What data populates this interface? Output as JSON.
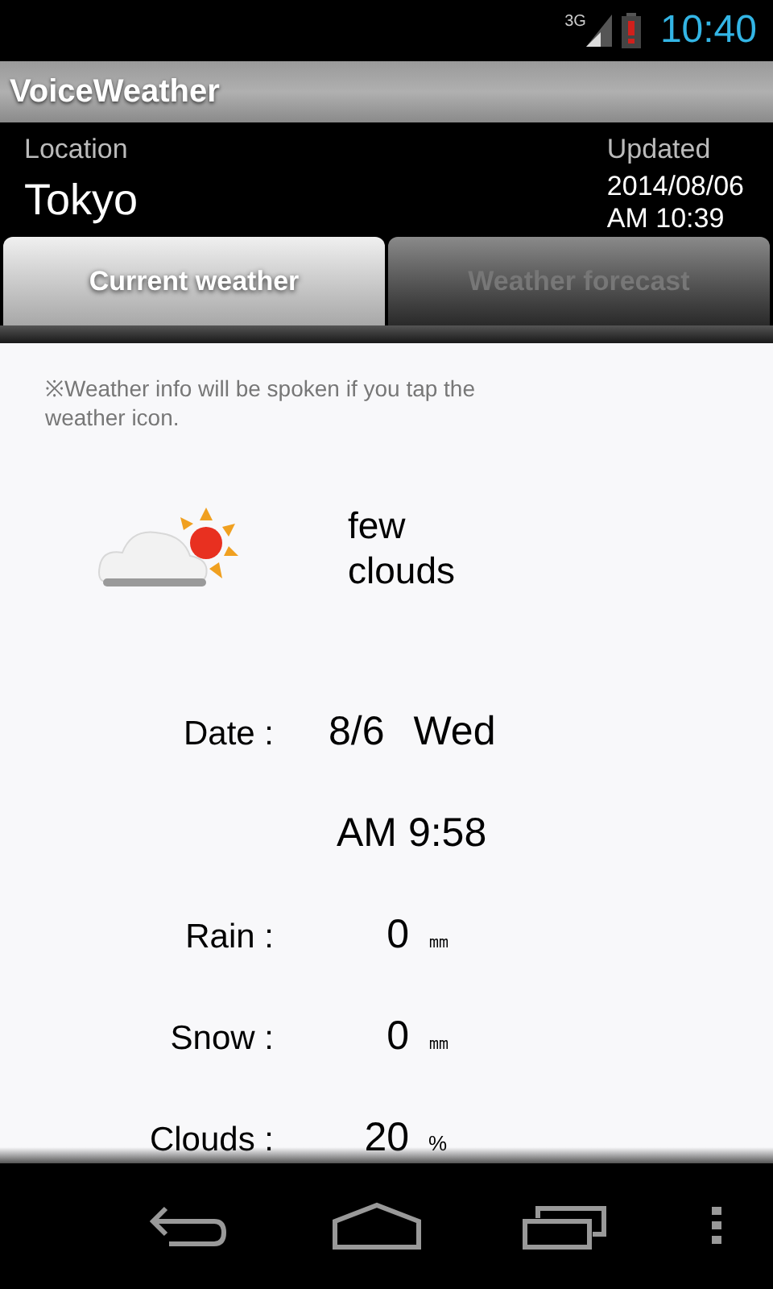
{
  "status_bar": {
    "network": "3G",
    "time": "10:40"
  },
  "app_bar": {
    "title": "VoiceWeather"
  },
  "header": {
    "location_label": "Location",
    "location": "Tokyo",
    "updated_label": "Updated",
    "updated_date": "2014/08/06",
    "updated_time": "AM 10:39"
  },
  "tabs": [
    {
      "label": "Current weather",
      "selected": true
    },
    {
      "label": "Weather forecast",
      "selected": false
    }
  ],
  "note": "※Weather info will be spoken if you tap the weather icon.",
  "condition": {
    "text": "few clouds"
  },
  "rows": [
    {
      "kind": "pair",
      "label": "Date :",
      "value": "8/6",
      "extra": "Wed"
    },
    {
      "kind": "single",
      "value": "AM 9:58"
    },
    {
      "kind": "measure",
      "label": "Rain :",
      "value": "0",
      "unit": "㎜"
    },
    {
      "kind": "measure",
      "label": "Snow :",
      "value": "0",
      "unit": "㎜"
    },
    {
      "kind": "measure",
      "label": "Clouds :",
      "value": "20",
      "unit": "%"
    }
  ]
}
